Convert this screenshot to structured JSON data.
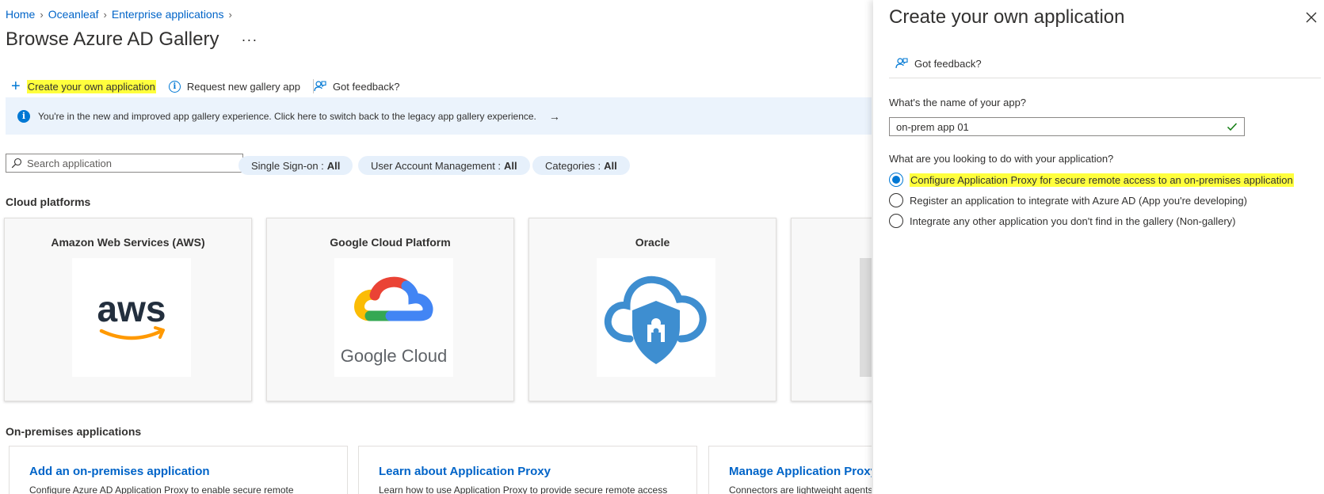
{
  "breadcrumb": [
    "Home",
    "Oceanleaf",
    "Enterprise applications"
  ],
  "page": {
    "title": "Browse Azure AD Gallery",
    "more": "···"
  },
  "toolbar": {
    "create_label": "Create your own application",
    "request_label": "Request new gallery app",
    "feedback_label": "Got feedback?"
  },
  "banner": {
    "text": "You're in the new and improved app gallery experience. Click here to switch back to the legacy app gallery experience.",
    "arrow": "→"
  },
  "search": {
    "placeholder": "Search application"
  },
  "filters": [
    {
      "label": "Single Sign-on :",
      "value": "All"
    },
    {
      "label": "User Account Management :",
      "value": "All"
    },
    {
      "label": "Categories :",
      "value": "All"
    }
  ],
  "cloud": {
    "title": "Cloud platforms",
    "cards": [
      {
        "title": "Amazon Web Services (AWS)",
        "logo_text": "aws"
      },
      {
        "title": "Google Cloud Platform",
        "logo_text": "Google Cloud"
      },
      {
        "title": "Oracle"
      }
    ]
  },
  "onprem": {
    "title": "On-premises applications",
    "cards": [
      {
        "title": "Add an on-premises application",
        "desc": "Configure Azure AD Application Proxy to enable secure remote"
      },
      {
        "title": "Learn about Application Proxy",
        "desc": "Learn how to use Application Proxy to provide secure remote access"
      },
      {
        "title": "Manage Application Proxy",
        "desc": "Connectors are lightweight agents"
      }
    ]
  },
  "panel": {
    "title": "Create your own application",
    "feedback_label": "Got feedback?",
    "name_label": "What's the name of your app?",
    "name_value": "on-prem app 01",
    "purpose_label": "What are you looking to do with your application?",
    "options": [
      {
        "label": "Configure Application Proxy for secure remote access to an on-premises application",
        "selected": true
      },
      {
        "label": "Register an application to integrate with Azure AD (App you're developing)",
        "selected": false
      },
      {
        "label": "Integrate any other application you don't find in the gallery (Non-gallery)",
        "selected": false
      }
    ]
  },
  "colors": {
    "accent": "#0078d4",
    "link": "#0064c8",
    "highlight": "#ffff3d",
    "banner_bg": "#ebf3fc",
    "success": "#107c10"
  }
}
